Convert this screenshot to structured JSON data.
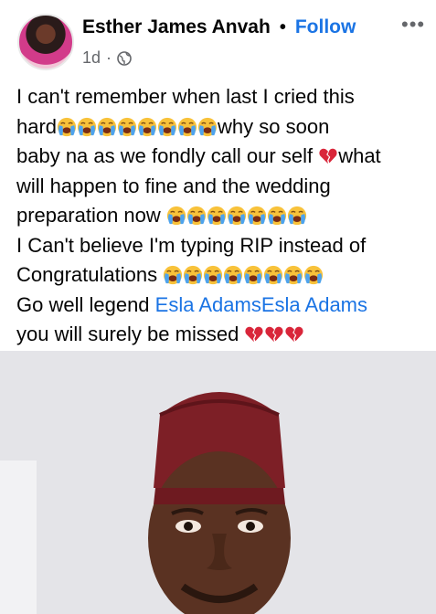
{
  "post": {
    "author_name": "Esther James Anvah",
    "separator": "•",
    "follow_label": "Follow",
    "more_label": "•••",
    "time_label": "1d",
    "meta_sep": "·",
    "audience_icon": "globe-icon",
    "lines": {
      "l1": "I can't remember when last I cried this",
      "l2_start": "hard",
      "l2_end": "why so soon",
      "l3_start": "baby na as we fondly call our self",
      "l3_end": "what",
      "l4": "will happen to fine and the wedding",
      "l5_start": "preparation now",
      "l6": "I Can't believe I'm typing RIP instead of",
      "l7_start": "Congratulations",
      "l8_start": "Go well legend",
      "l8_mention": "Esla AdamsEsla Adams",
      "l9_start": "you will surely be missed"
    },
    "emoji": {
      "crying": "loudly-crying-face-emoji",
      "heart": "broken-heart-emoji"
    },
    "photo_alt": "Portrait of a smiling man wearing a red cap"
  }
}
